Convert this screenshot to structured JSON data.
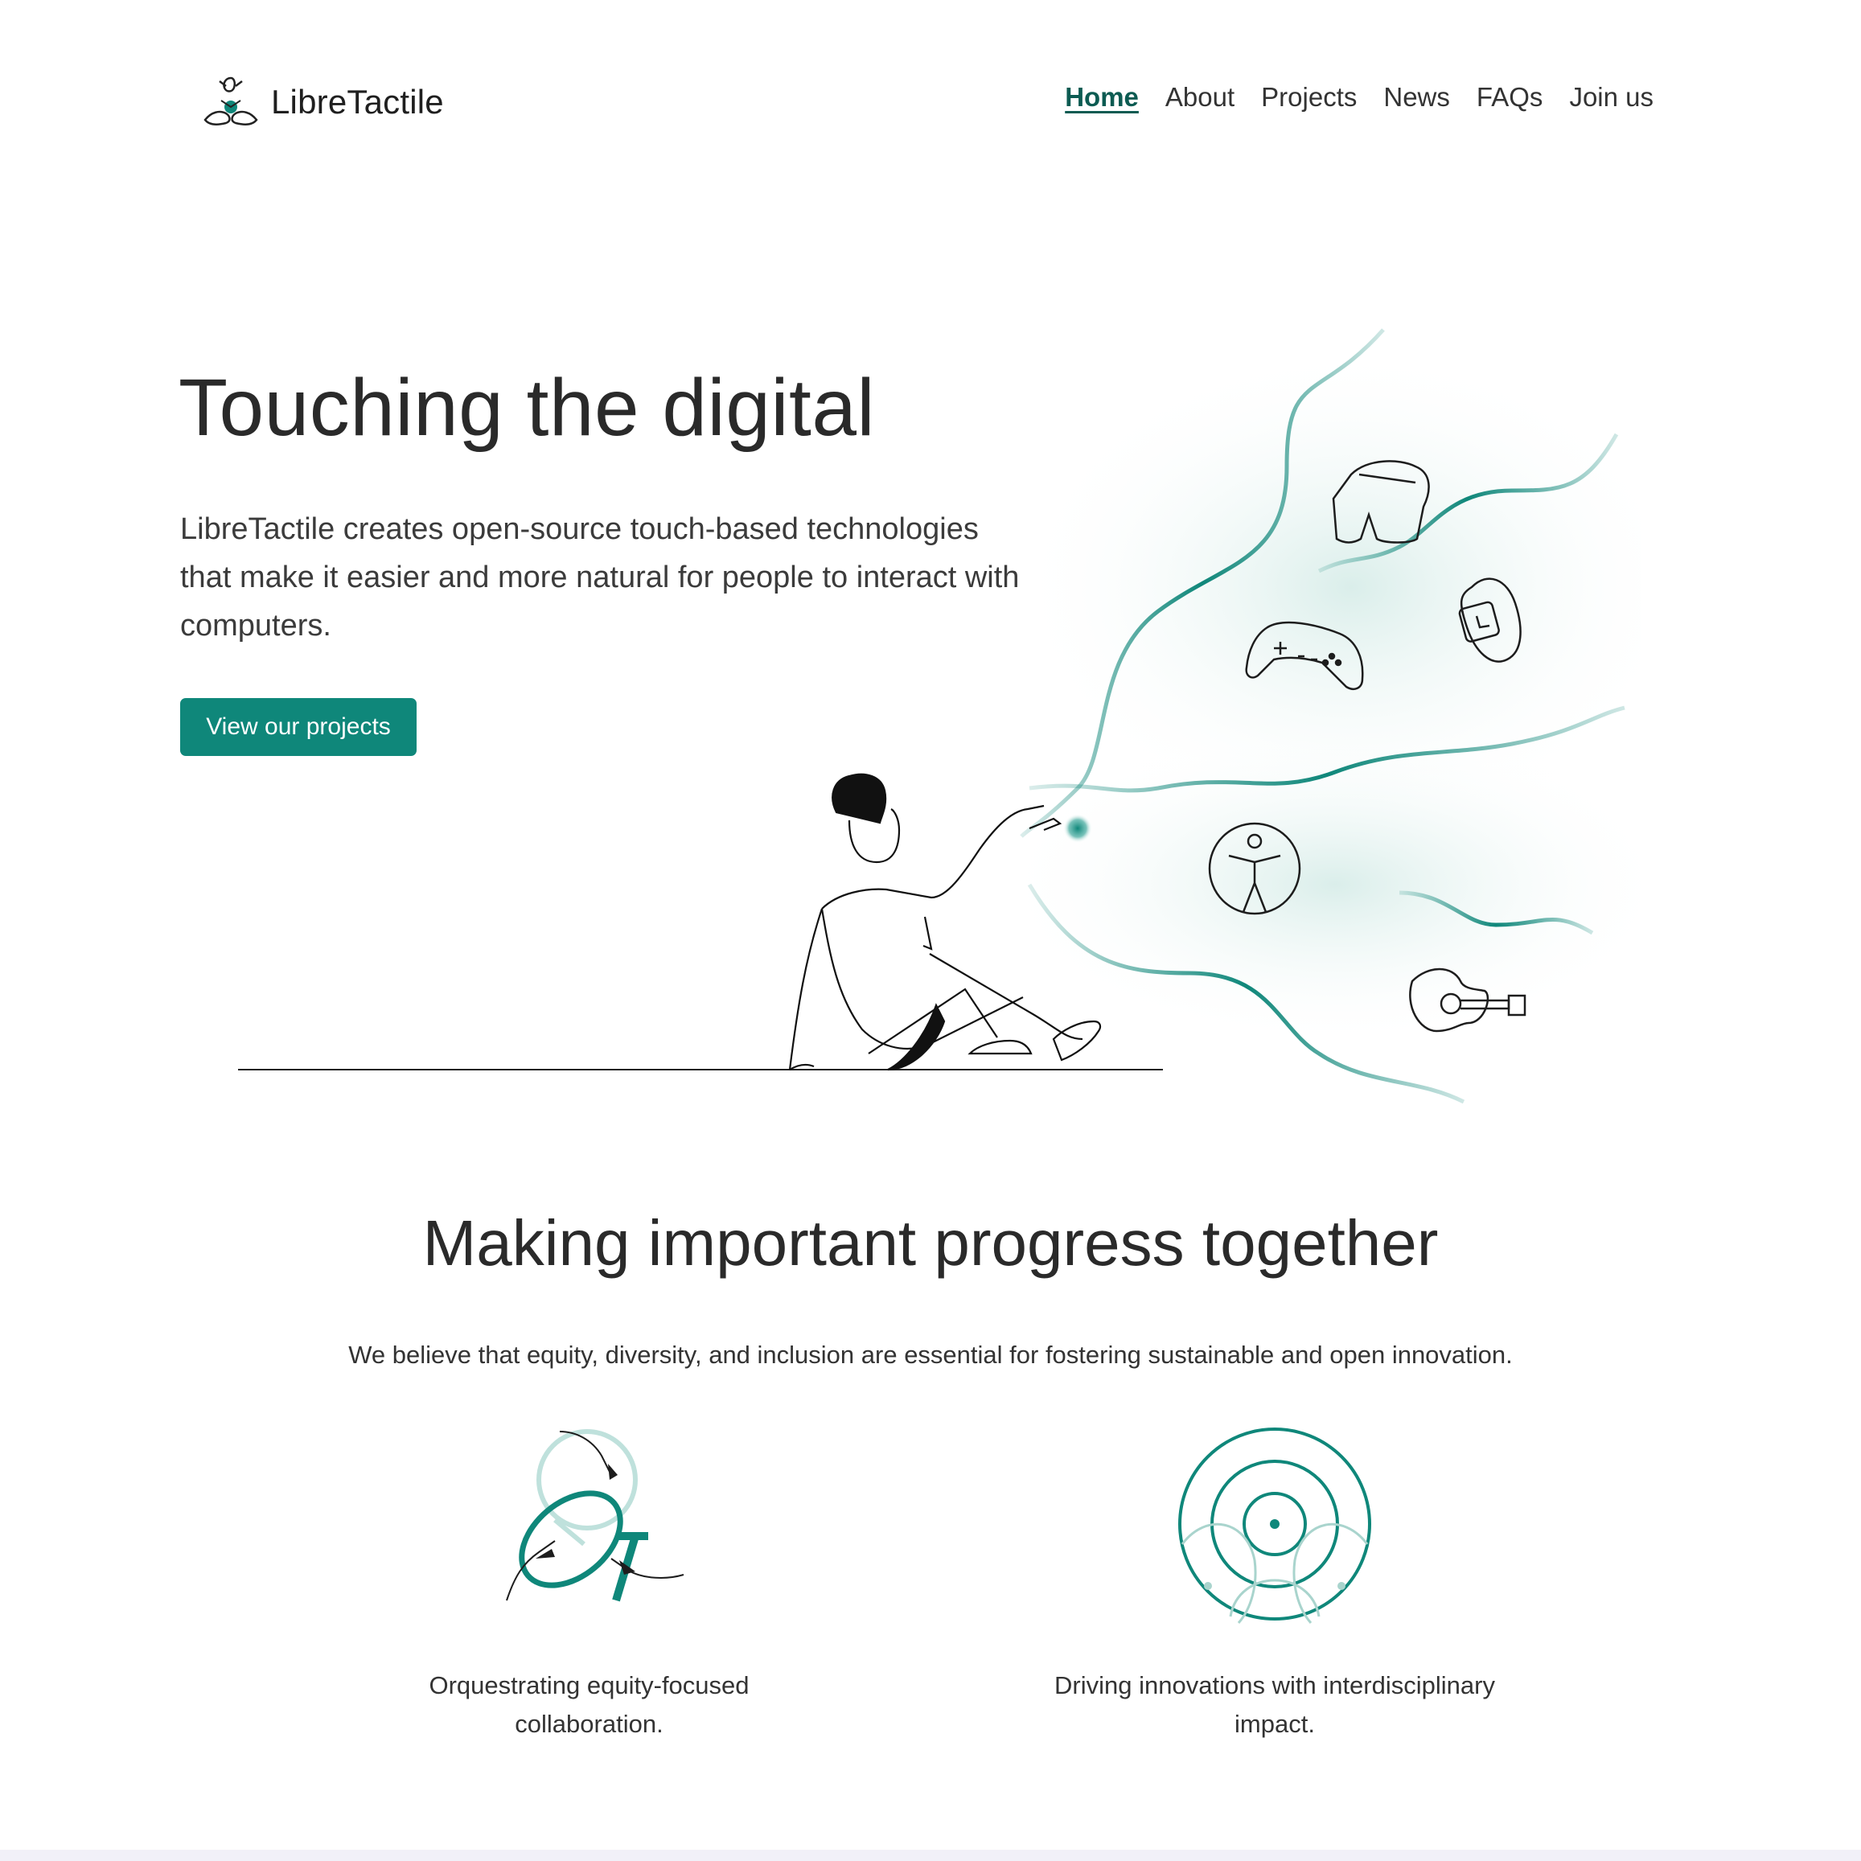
{
  "brand": {
    "name": "LibreTactile",
    "accent": "#0f877a",
    "accent_dark": "#0c5b52",
    "logo_icon": "tactile-hands-logo-icon"
  },
  "nav": {
    "items": [
      {
        "label": "Home",
        "active": true
      },
      {
        "label": "About",
        "active": false
      },
      {
        "label": "Projects",
        "active": false
      },
      {
        "label": "News",
        "active": false
      },
      {
        "label": "FAQs",
        "active": false
      },
      {
        "label": "Join us",
        "active": false
      }
    ]
  },
  "hero": {
    "title": "Touching the digital",
    "description": "LibreTactile creates open-source touch-based technologies that make it easier and more natural for people to interact with computers.",
    "cta_label": "View our projects",
    "illustration_icons": [
      "vr-headset-icon",
      "smartwatch-icon",
      "gamepad-icon",
      "accessibility-icon",
      "guitar-icon"
    ]
  },
  "progress": {
    "title": "Making important progress together",
    "lead": "We believe that equity, diversity, and inclusion are essential for fostering sustainable and open innovation.",
    "features": [
      {
        "icon": "collaboration-hands-icon",
        "caption_line1": "Orquestrating equity-focused",
        "caption_line2": "collaboration."
      },
      {
        "icon": "concentric-circles-icon",
        "caption_line1": "Driving innovations with interdisciplinary",
        "caption_line2": "impact."
      }
    ]
  }
}
